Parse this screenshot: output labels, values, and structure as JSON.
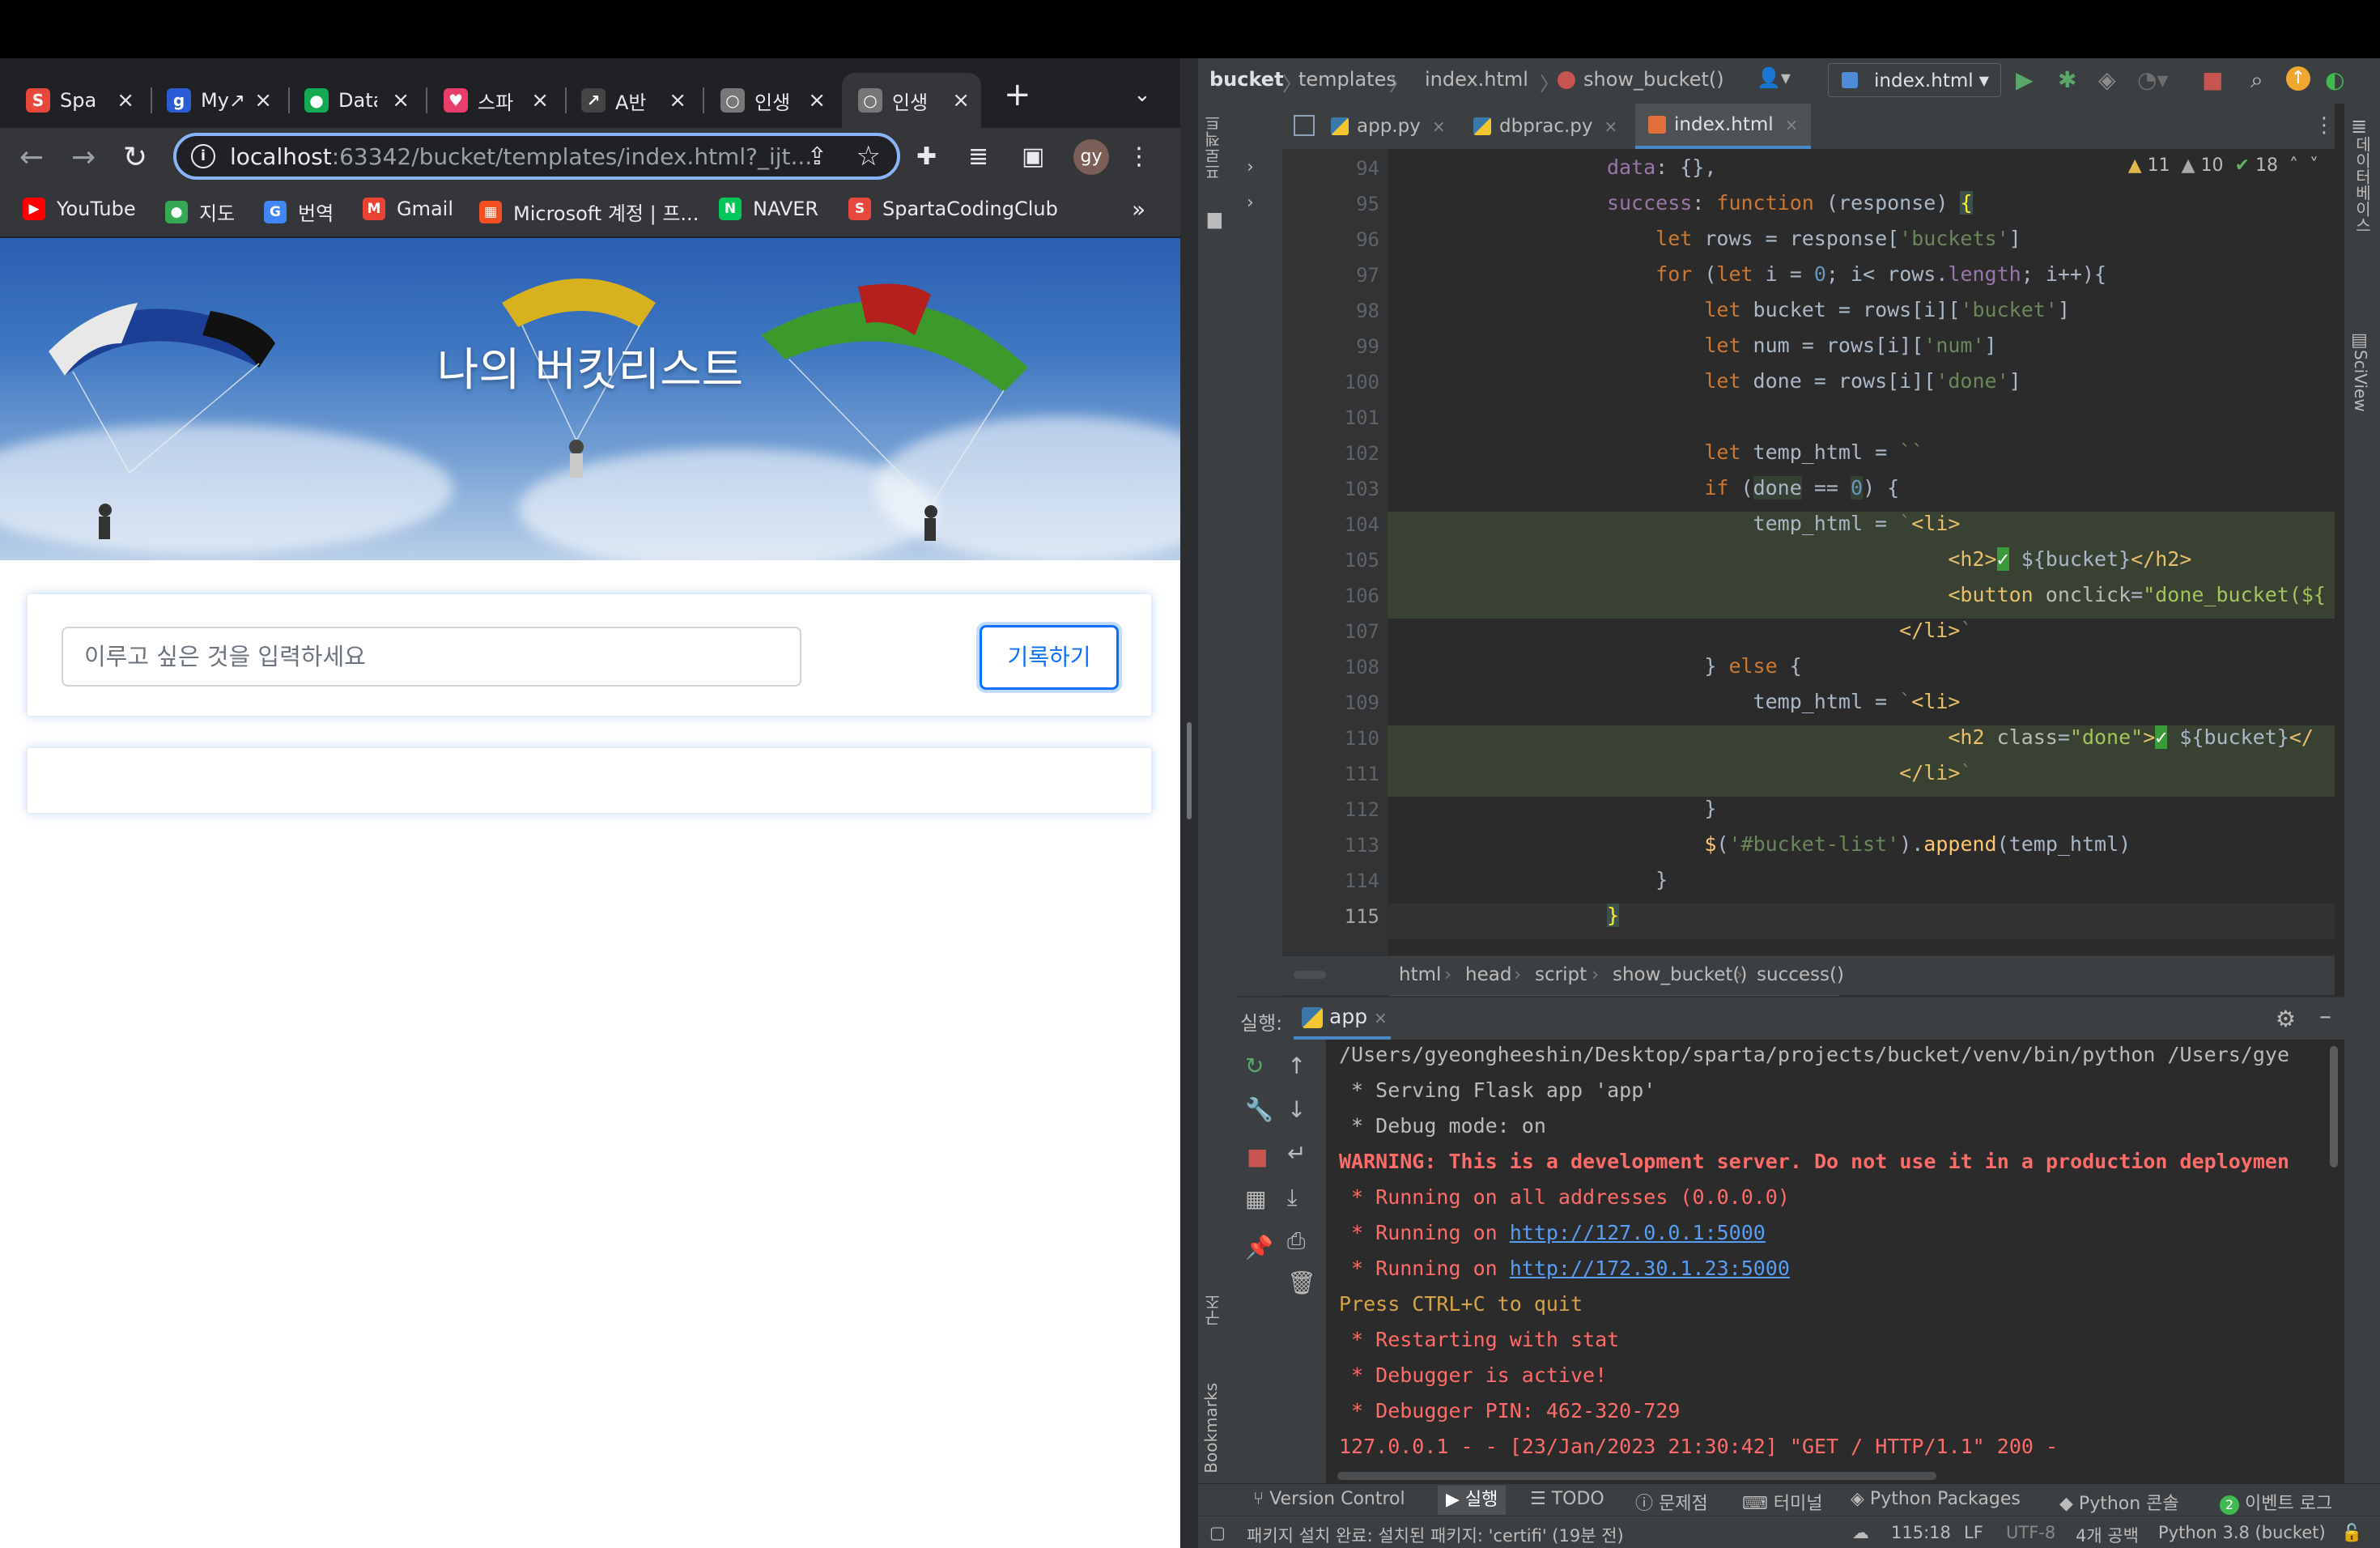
{
  "browser": {
    "tabs": [
      {
        "title": "Spa",
        "fav_color": "#e8473b",
        "fav_glyph": "S"
      },
      {
        "title": "My↗",
        "fav_color": "#2c5bd6",
        "fav_glyph": "g"
      },
      {
        "title": "Data",
        "fav_color": "#13aa52",
        "fav_glyph": "●"
      },
      {
        "title": "스파",
        "fav_color": "#e83e6c",
        "fav_glyph": "♥"
      },
      {
        "title": "A반",
        "fav_color": "#444444",
        "fav_glyph": "↗"
      },
      {
        "title": "인생",
        "fav_color": "#777777",
        "fav_glyph": "○"
      },
      {
        "title": "인생",
        "fav_color": "#777777",
        "fav_glyph": "○"
      }
    ],
    "url_host": "localhost",
    "url_rest": ":63342/bucket/templates/index.html?_ijt...",
    "avatar": "gy",
    "bookmarks": [
      {
        "label": "YouTube",
        "color": "#ff0000",
        "glyph": "▶"
      },
      {
        "label": "지도",
        "color": "#34a853",
        "glyph": "●"
      },
      {
        "label": "번역",
        "color": "#4285f4",
        "glyph": "G"
      },
      {
        "label": "Gmail",
        "color": "#ea4335",
        "glyph": "M"
      },
      {
        "label": "Microsoft 계정 | 프...",
        "color": "#f25022",
        "glyph": "▦"
      },
      {
        "label": "NAVER",
        "color": "#03c75a",
        "glyph": "N"
      },
      {
        "label": "SpartaCodingClub",
        "color": "#e8473b",
        "glyph": "S"
      }
    ]
  },
  "page": {
    "hero_title": "나의 버킷리스트",
    "input_placeholder": "이루고 싶은 것을 입력하세요",
    "submit_label": "기록하기"
  },
  "ide": {
    "breadcrumb": [
      "bucket",
      "templates",
      "index.html",
      "show_bucket()"
    ],
    "run_config": "index.html",
    "editor_tabs": [
      "app.py",
      "dbprac.py",
      "index.html"
    ],
    "inspections": {
      "warnings": "11",
      "weak_warnings": "10",
      "ok": "18"
    },
    "line_numbers": [
      "94",
      "95",
      "96",
      "97",
      "98",
      "99",
      "100",
      "101",
      "102",
      "103",
      "104",
      "105",
      "106",
      "107",
      "108",
      "109",
      "110",
      "111",
      "112",
      "113",
      "114",
      "115"
    ],
    "code_breadcrumb": [
      "html",
      "head",
      "script",
      "show_bucket()",
      "success()"
    ],
    "run_label": "실행:",
    "run_tab": "app",
    "console": [
      "/Users/gyeongheeshin/Desktop/sparta/projects/bucket/venv/bin/python /Users/gye",
      " * Serving Flask app 'app'",
      " * Debug mode: on",
      "WARNING: This is a development server. Do not use it in a production deploymen",
      " * Running on all addresses (0.0.0.0)",
      " * Running on ",
      " * Running on ",
      "Press CTRL+C to quit",
      " * Restarting with stat",
      " * Debugger is active!",
      " * Debugger PIN: 462-320-729",
      "127.0.0.1 - - [23/Jan/2023 21:30:42] \"GET / HTTP/1.1\" 200 -"
    ],
    "console_links": [
      "http://127.0.0.1:5000",
      "http://172.30.1.23:5000"
    ],
    "left_labels": [
      "프로젝트",
      "구조",
      "Bookmarks"
    ],
    "right_labels": [
      "데이터베이스",
      "SciView"
    ],
    "tool_windows": [
      "Version Control",
      "실행",
      "TODO",
      "문제점",
      "터미널",
      "Python Packages",
      "Python 콘솔",
      "이벤트 로그"
    ],
    "event_count": "2",
    "status_message": "패키지 설치 완료: 설치된 패키지: 'certifi' (19분 전)",
    "cursor_pos": "115:18",
    "line_sep": "LF",
    "encoding": "UTF-8",
    "indent": "4개 공백",
    "interpreter": "Python 3.8 (bucket)"
  }
}
